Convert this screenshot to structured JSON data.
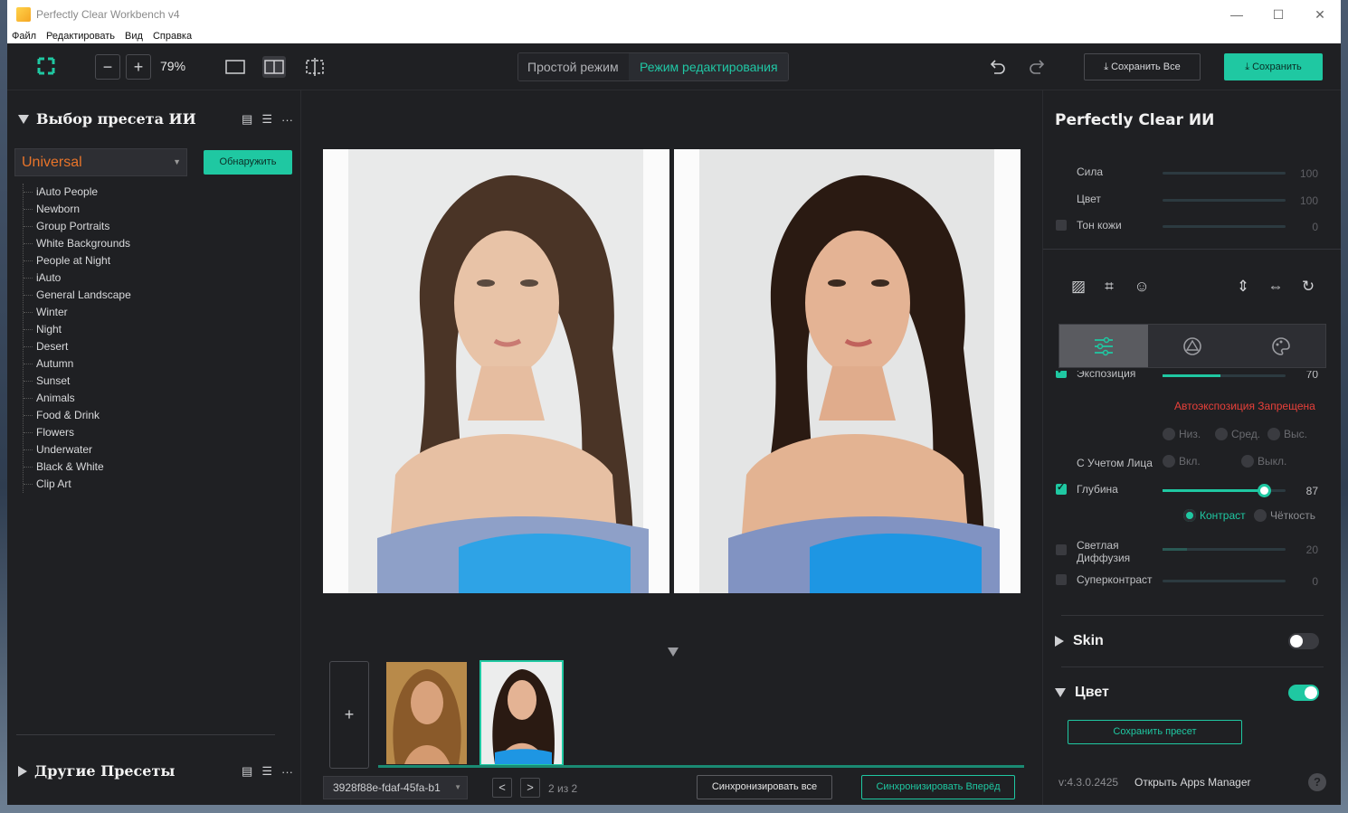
{
  "window": {
    "title": "Perfectly Clear Workbench v4",
    "min": "—",
    "max": "☐",
    "close": "✕"
  },
  "menu": [
    "Файл",
    "Редактировать",
    "Вид",
    "Справка"
  ],
  "toolbar": {
    "zoom_out": "−",
    "zoom_in": "+",
    "zoom": "79%",
    "mode_simple": "Простой режим",
    "mode_edit": "Режим редактирования",
    "save_all": "Сохранить Все",
    "save": "Сохранить"
  },
  "left": {
    "ai_preset_title": "Выбор пресета ИИ",
    "preset_selected": "Universal",
    "detect_button": "Обнаружить",
    "presets": [
      "iAuto People",
      "Newborn",
      "Group Portraits",
      "White Backgrounds",
      "People at Night",
      "iAuto",
      "General Landscape",
      "Winter",
      "Night",
      "Desert",
      "Autumn",
      "Sunset",
      "Animals",
      "Food & Drink",
      "Flowers",
      "Underwater",
      "Black & White",
      "Clip Art"
    ],
    "other_presets_title": "Другие Пресеты",
    "more": "···"
  },
  "center": {
    "add": "+",
    "file_name": "3928f88e-fdaf-45fa-b1",
    "prev": "<",
    "next": ">",
    "pager": "2 из 2",
    "sync_all": "Синхронизировать все",
    "sync_forward": "Синхронизировать Вперёд"
  },
  "right": {
    "title": "Perfectly Clear ИИ",
    "sliders_top": [
      {
        "label": "Сила",
        "value": "100",
        "fraction": 1.0
      },
      {
        "label": "Цвет",
        "value": "100",
        "fraction": 1.0
      },
      {
        "label": "Тон кожи",
        "value": "0",
        "fraction": 0.0
      }
    ],
    "exposure_label": "Экспозиция",
    "exposure_value": "70",
    "exposure_fraction": 0.47,
    "auto_exposure_warning": "Автоэкспозиция Запрещена",
    "levels": [
      "Низ.",
      "Сред.",
      "Выс."
    ],
    "face_aware_label": "С Учетом Лица",
    "face_on": "Вкл.",
    "face_off": "Выкл.",
    "depth_label": "Глубина",
    "depth_value": "87",
    "depth_fraction": 0.82,
    "contrast_opt": "Контраст",
    "clarity_opt": "Чёткость",
    "light_diffusion_label": "Светлая Диффузия",
    "light_diffusion_value": "20",
    "light_diffusion_fraction": 0.2,
    "supercontrast_label": "Суперконтраст",
    "supercontrast_value": "0",
    "supercontrast_fraction": 0.0,
    "skin_title": "Skin",
    "skin_enabled": false,
    "color_title": "Цвет",
    "color_enabled": true,
    "save_preset": "Сохранить пресет",
    "version": "v:4.3.0.2425",
    "apps_manager": "Открыть Apps Manager",
    "help": "?"
  },
  "colors": {
    "accent": "#1fc8a2",
    "warning": "#e8403a",
    "preset": "#e8742a",
    "background": "#1f2023"
  }
}
